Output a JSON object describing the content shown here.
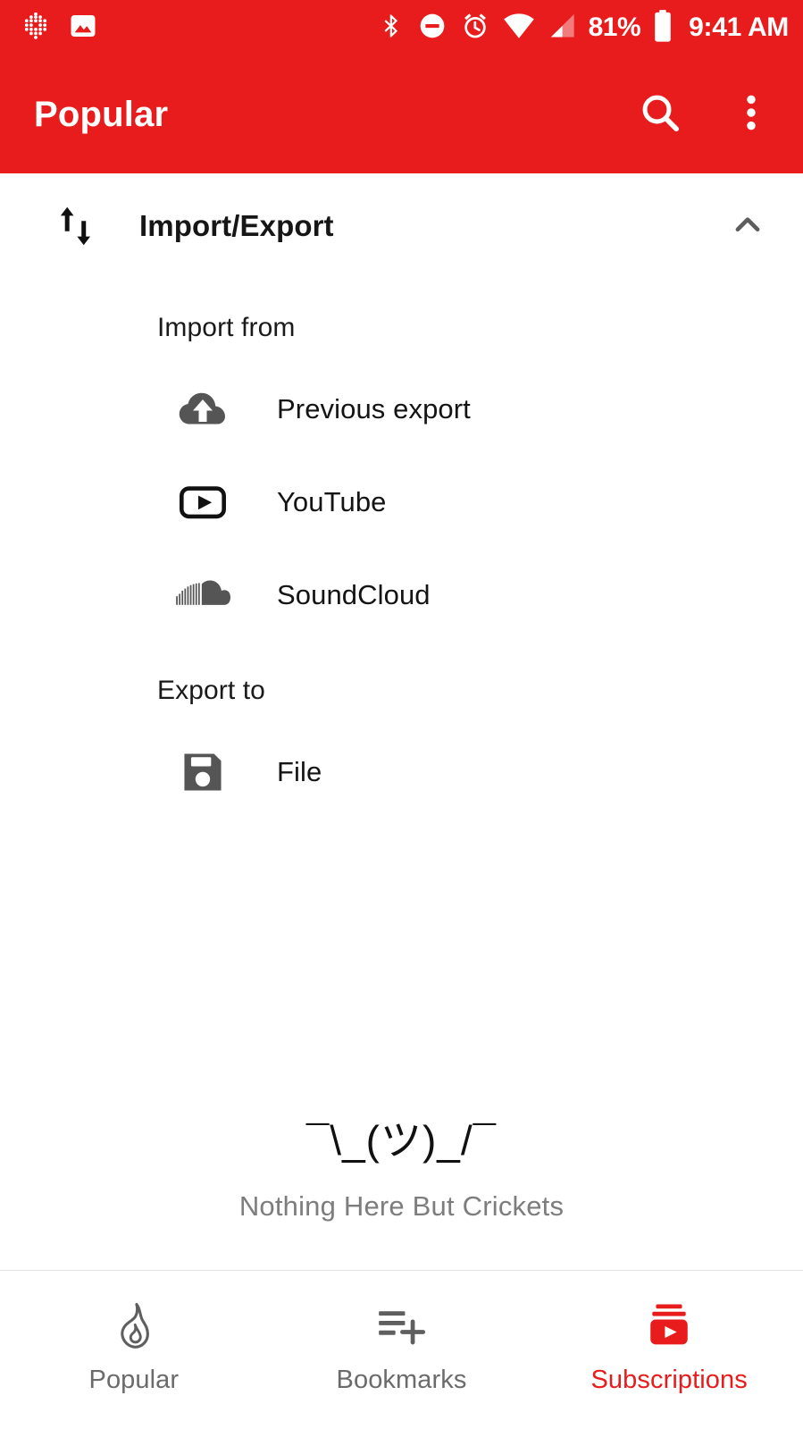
{
  "theme": {
    "accent": "#E81C1C",
    "app_bar_bg": "#E81C1C",
    "page_bg": "#FFFFFF",
    "icon_gray": "#555555",
    "muted_text": "#7D7D7D"
  },
  "status_bar": {
    "left_icons": [
      {
        "name": "dotted-app-icon",
        "label": "dots"
      },
      {
        "name": "image-icon",
        "label": "image"
      }
    ],
    "right_icons": [
      {
        "name": "bluetooth-icon",
        "label": "Bluetooth"
      },
      {
        "name": "do-not-disturb-icon",
        "label": "Do Not Disturb"
      },
      {
        "name": "alarm-icon",
        "label": "Alarm"
      },
      {
        "name": "wifi-icon",
        "label": "Wi-Fi"
      },
      {
        "name": "cell-signal-icon",
        "label": "Cell signal"
      }
    ],
    "battery_percent": "81%",
    "battery_icon": "battery-icon",
    "time": "9:41 AM"
  },
  "app_bar": {
    "title": "Popular",
    "search_icon": "search-icon",
    "overflow_icon": "more-vertical-icon"
  },
  "import_export": {
    "icon": "import-export-icon",
    "title": "Import/Export",
    "collapse_icon": "chevron-up-icon",
    "expanded": true,
    "import_section_label": "Import from",
    "import_options": [
      {
        "icon": "cloud-upload-icon",
        "label": "Previous export"
      },
      {
        "icon": "youtube-icon",
        "label": "YouTube"
      },
      {
        "icon": "soundcloud-icon",
        "label": "SoundCloud"
      }
    ],
    "export_section_label": "Export to",
    "export_options": [
      {
        "icon": "save-file-icon",
        "label": "File"
      }
    ]
  },
  "empty_state": {
    "art": "¯\\_(ツ)_/¯",
    "message": "Nothing Here But Crickets"
  },
  "bottom_nav": {
    "items": [
      {
        "icon": "flame-icon",
        "label": "Popular",
        "active": false
      },
      {
        "icon": "playlist-add-icon",
        "label": "Bookmarks",
        "active": false
      },
      {
        "icon": "subscriptions-icon",
        "label": "Subscriptions",
        "active": true
      }
    ]
  }
}
